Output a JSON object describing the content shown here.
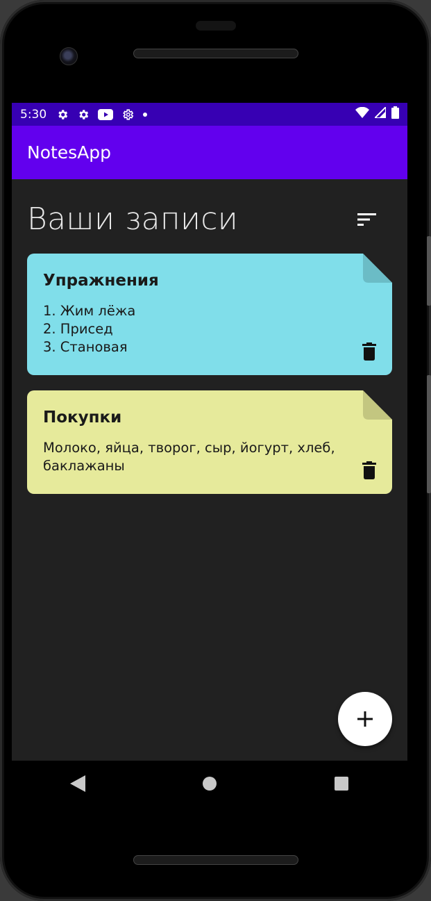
{
  "status_bar": {
    "time": "5:30",
    "left_icons": [
      "gear-icon",
      "gear-icon",
      "youtube-icon",
      "settings-outline-icon",
      "dot-icon"
    ],
    "right_icons": [
      "wifi-icon",
      "signal-icon",
      "battery-icon"
    ]
  },
  "app_bar": {
    "title": "NotesApp",
    "color": "#6200ee"
  },
  "main": {
    "title": "Ваши записи",
    "sort_icon": "sort-icon"
  },
  "notes": [
    {
      "title": "Упражнения",
      "body": "1. Жим лёжа\n2. Присед\n3. Становая",
      "color": "#80deea",
      "fold_color": "#6bbcc6"
    },
    {
      "title": "Покупки",
      "body": "Молоко, яйца, творог, сыр, йогурт, хлеб, баклажаны",
      "color": "#e6ea9b",
      "fold_color": "#c3c680"
    }
  ],
  "fab": {
    "icon": "plus-icon"
  },
  "navigation": [
    "back-icon",
    "home-icon",
    "recents-icon"
  ],
  "colors": {
    "status_bar": "#3700b3",
    "background": "#212121"
  }
}
